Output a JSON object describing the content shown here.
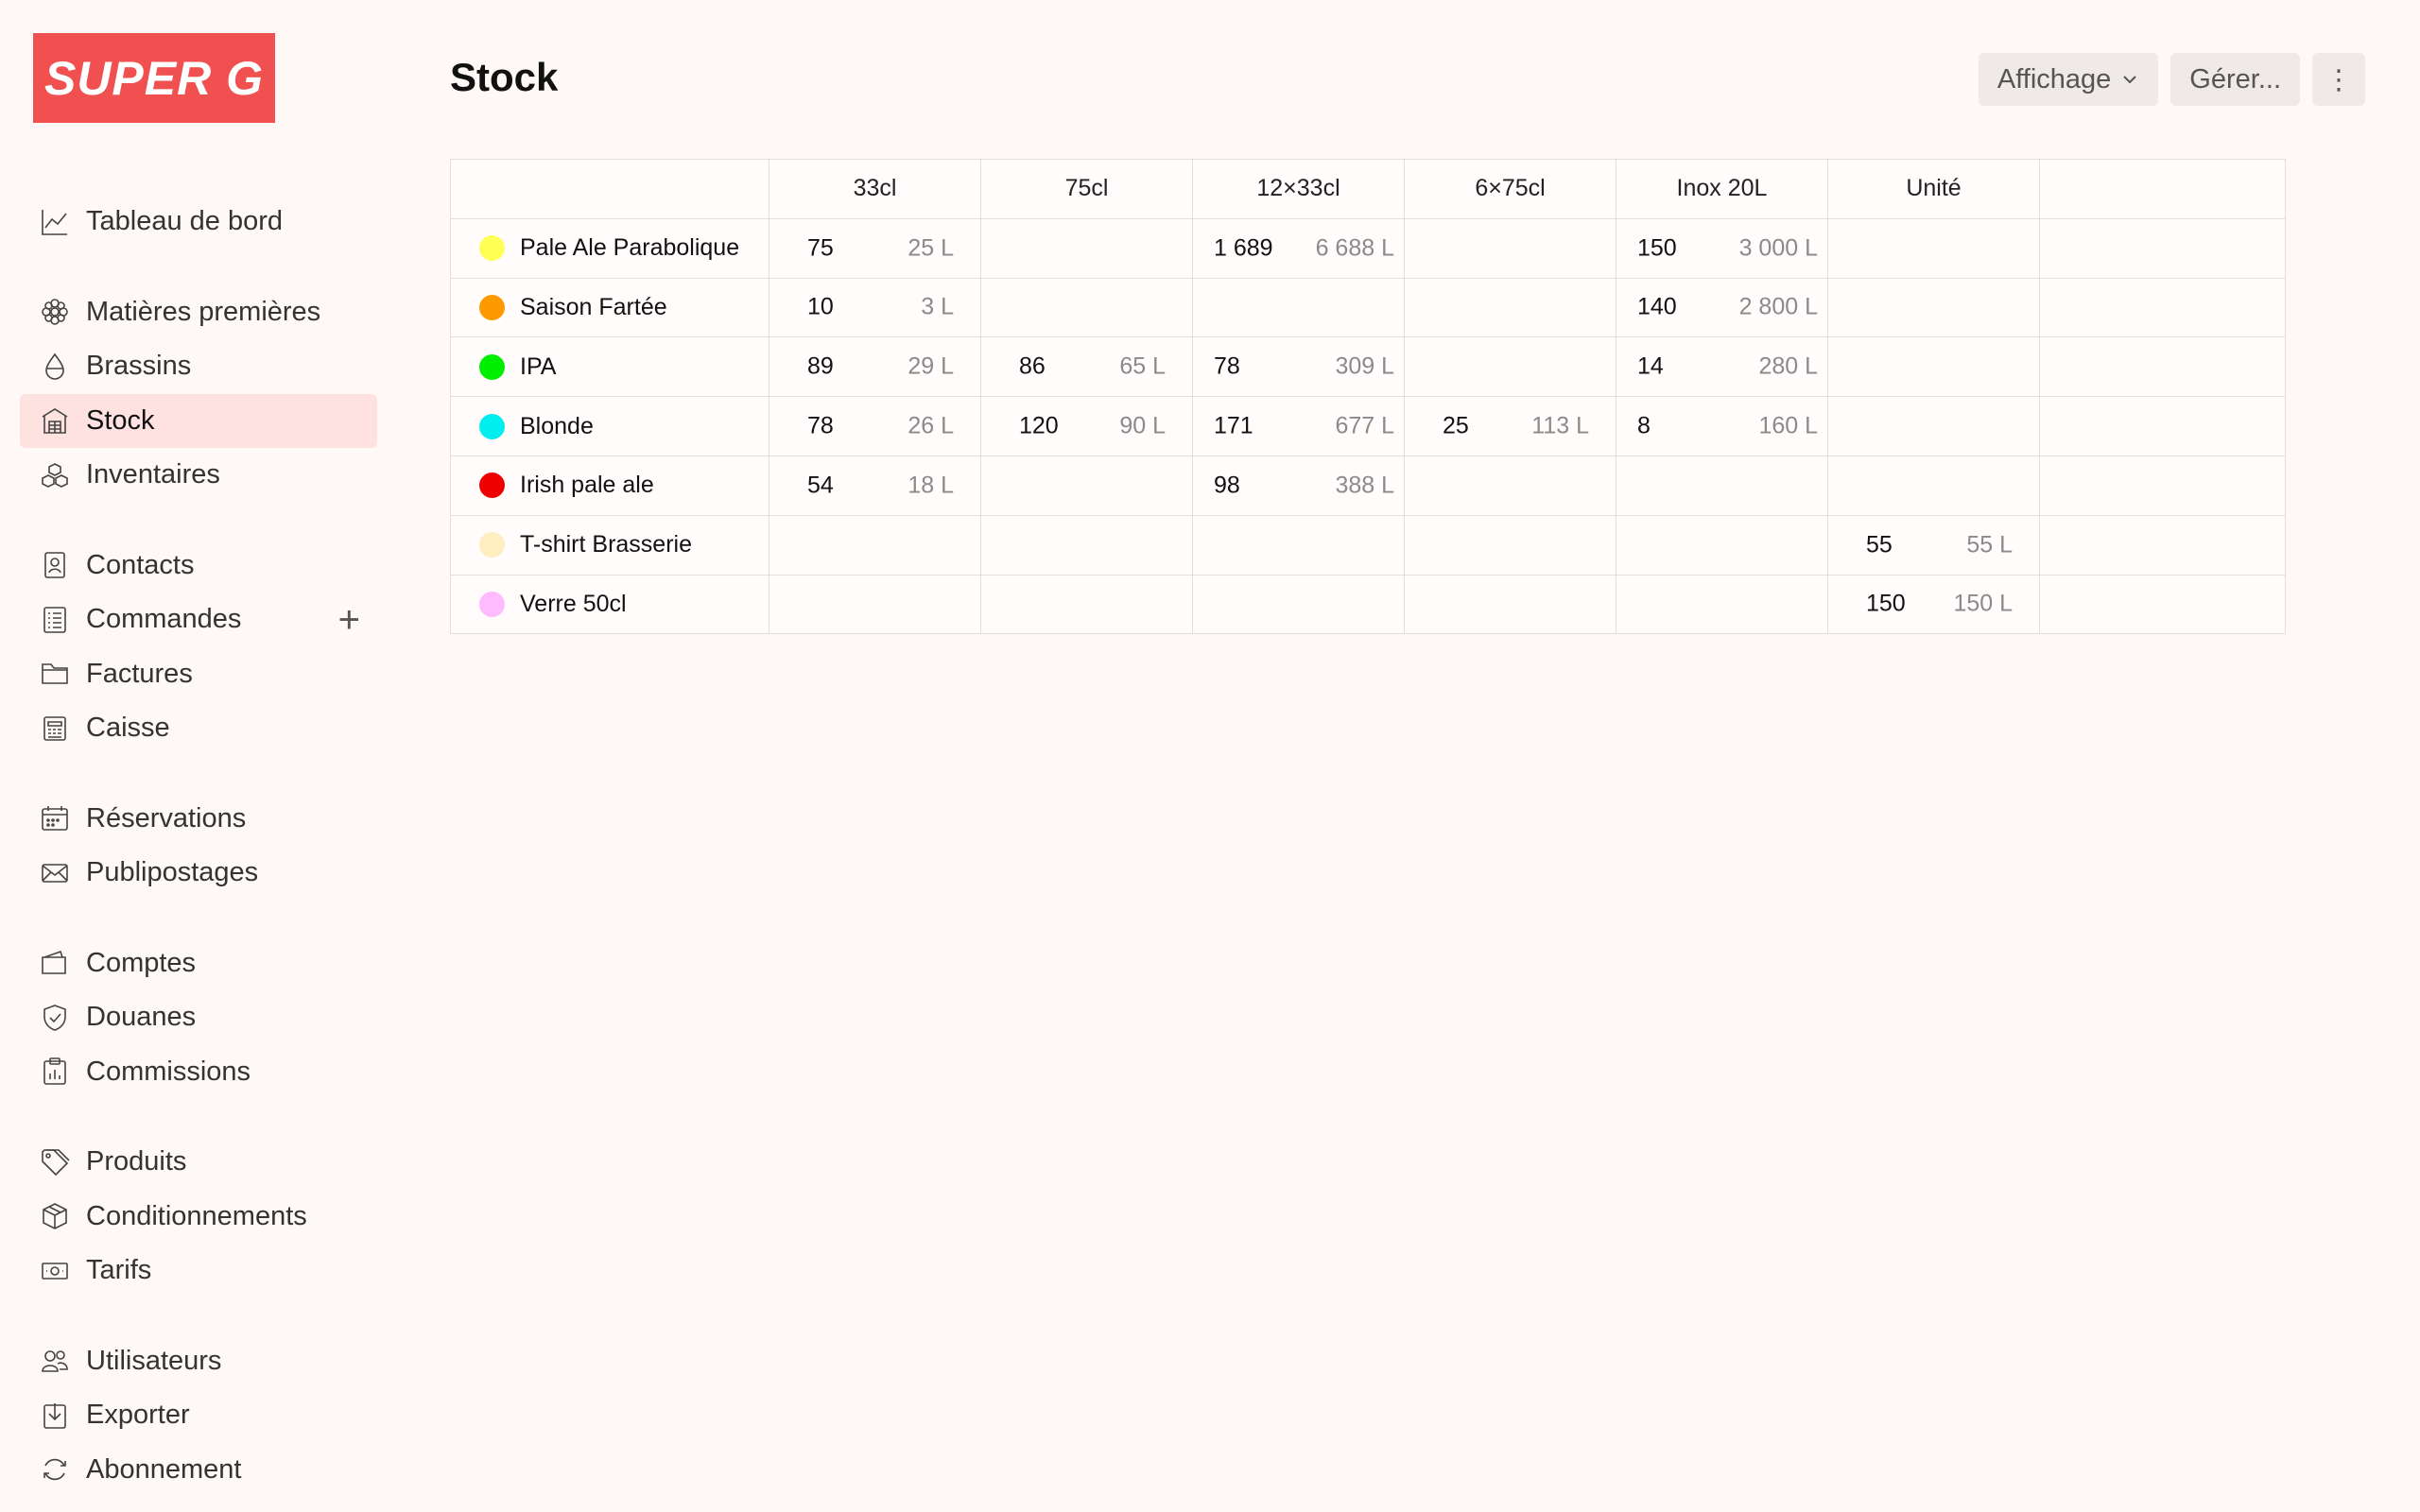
{
  "brand": {
    "logo_text": "SUPER G",
    "logo_color": "#f05050"
  },
  "sidebar": {
    "groups": [
      [
        {
          "label": "Tableau de bord",
          "icon": "chart-line-icon"
        }
      ],
      [
        {
          "label": "Matières premières",
          "icon": "hops-icon"
        },
        {
          "label": "Brassins",
          "icon": "drop-icon"
        },
        {
          "label": "Stock",
          "icon": "warehouse-icon",
          "active": true
        },
        {
          "label": "Inventaires",
          "icon": "boxes-icon"
        }
      ],
      [
        {
          "label": "Contacts",
          "icon": "contact-card-icon"
        },
        {
          "label": "Commandes",
          "icon": "order-list-icon",
          "action": "+"
        },
        {
          "label": "Factures",
          "icon": "folder-icon"
        },
        {
          "label": "Caisse",
          "icon": "register-icon"
        }
      ],
      [
        {
          "label": "Réservations",
          "icon": "calendar-icon"
        },
        {
          "label": "Publipostages",
          "icon": "envelope-icon"
        }
      ],
      [
        {
          "label": "Comptes",
          "icon": "wallet-icon"
        },
        {
          "label": "Douanes",
          "icon": "shield-check-icon"
        },
        {
          "label": "Commissions",
          "icon": "clipboard-chart-icon"
        }
      ],
      [
        {
          "label": "Produits",
          "icon": "tag-icon"
        },
        {
          "label": "Conditionnements",
          "icon": "package-icon"
        },
        {
          "label": "Tarifs",
          "icon": "banknote-icon"
        }
      ],
      [
        {
          "label": "Utilisateurs",
          "icon": "users-icon"
        },
        {
          "label": "Exporter",
          "icon": "export-icon"
        },
        {
          "label": "Abonnement",
          "icon": "refresh-icon"
        }
      ]
    ]
  },
  "header": {
    "title": "Stock",
    "view_button": "Affichage",
    "manage_button": "Gérer...",
    "more_button": "⋮"
  },
  "table": {
    "columns": [
      "33cl",
      "75cl",
      "12×33cl",
      "6×75cl",
      "Inox 20L",
      "Unité"
    ],
    "rows": [
      {
        "name": "Pale Ale Parabolique",
        "color": "#ffff55",
        "cells": [
          {
            "q": "75",
            "v": "25 L"
          },
          null,
          {
            "q": "1 689",
            "v": "6 688 L"
          },
          null,
          {
            "q": "150",
            "v": "3 000 L"
          },
          null
        ]
      },
      {
        "name": "Saison Fartée",
        "color": "#ff9900",
        "cells": [
          {
            "q": "10",
            "v": "3 L"
          },
          null,
          null,
          null,
          {
            "q": "140",
            "v": "2 800 L"
          },
          null
        ]
      },
      {
        "name": "IPA",
        "color": "#00ee00",
        "cells": [
          {
            "q": "89",
            "v": "29 L"
          },
          {
            "q": "86",
            "v": "65 L"
          },
          {
            "q": "78",
            "v": "309 L"
          },
          null,
          {
            "q": "14",
            "v": "280 L"
          },
          null
        ]
      },
      {
        "name": "Blonde",
        "color": "#00eeee",
        "cells": [
          {
            "q": "78",
            "v": "26 L"
          },
          {
            "q": "120",
            "v": "90 L"
          },
          {
            "q": "171",
            "v": "677 L"
          },
          {
            "q": "25",
            "v": "113 L"
          },
          {
            "q": "8",
            "v": "160 L"
          },
          null
        ]
      },
      {
        "name": "Irish pale ale",
        "color": "#ee0000",
        "cells": [
          {
            "q": "54",
            "v": "18 L"
          },
          null,
          {
            "q": "98",
            "v": "388 L"
          },
          null,
          null,
          null
        ]
      },
      {
        "name": "T-shirt Brasserie",
        "color": "#ffeec0",
        "cells": [
          null,
          null,
          null,
          null,
          null,
          {
            "q": "55",
            "v": "55 L"
          }
        ]
      },
      {
        "name": "Verre 50cl",
        "color": "#ffbbff",
        "cells": [
          null,
          null,
          null,
          null,
          null,
          {
            "q": "150",
            "v": "150 L"
          }
        ]
      }
    ]
  }
}
